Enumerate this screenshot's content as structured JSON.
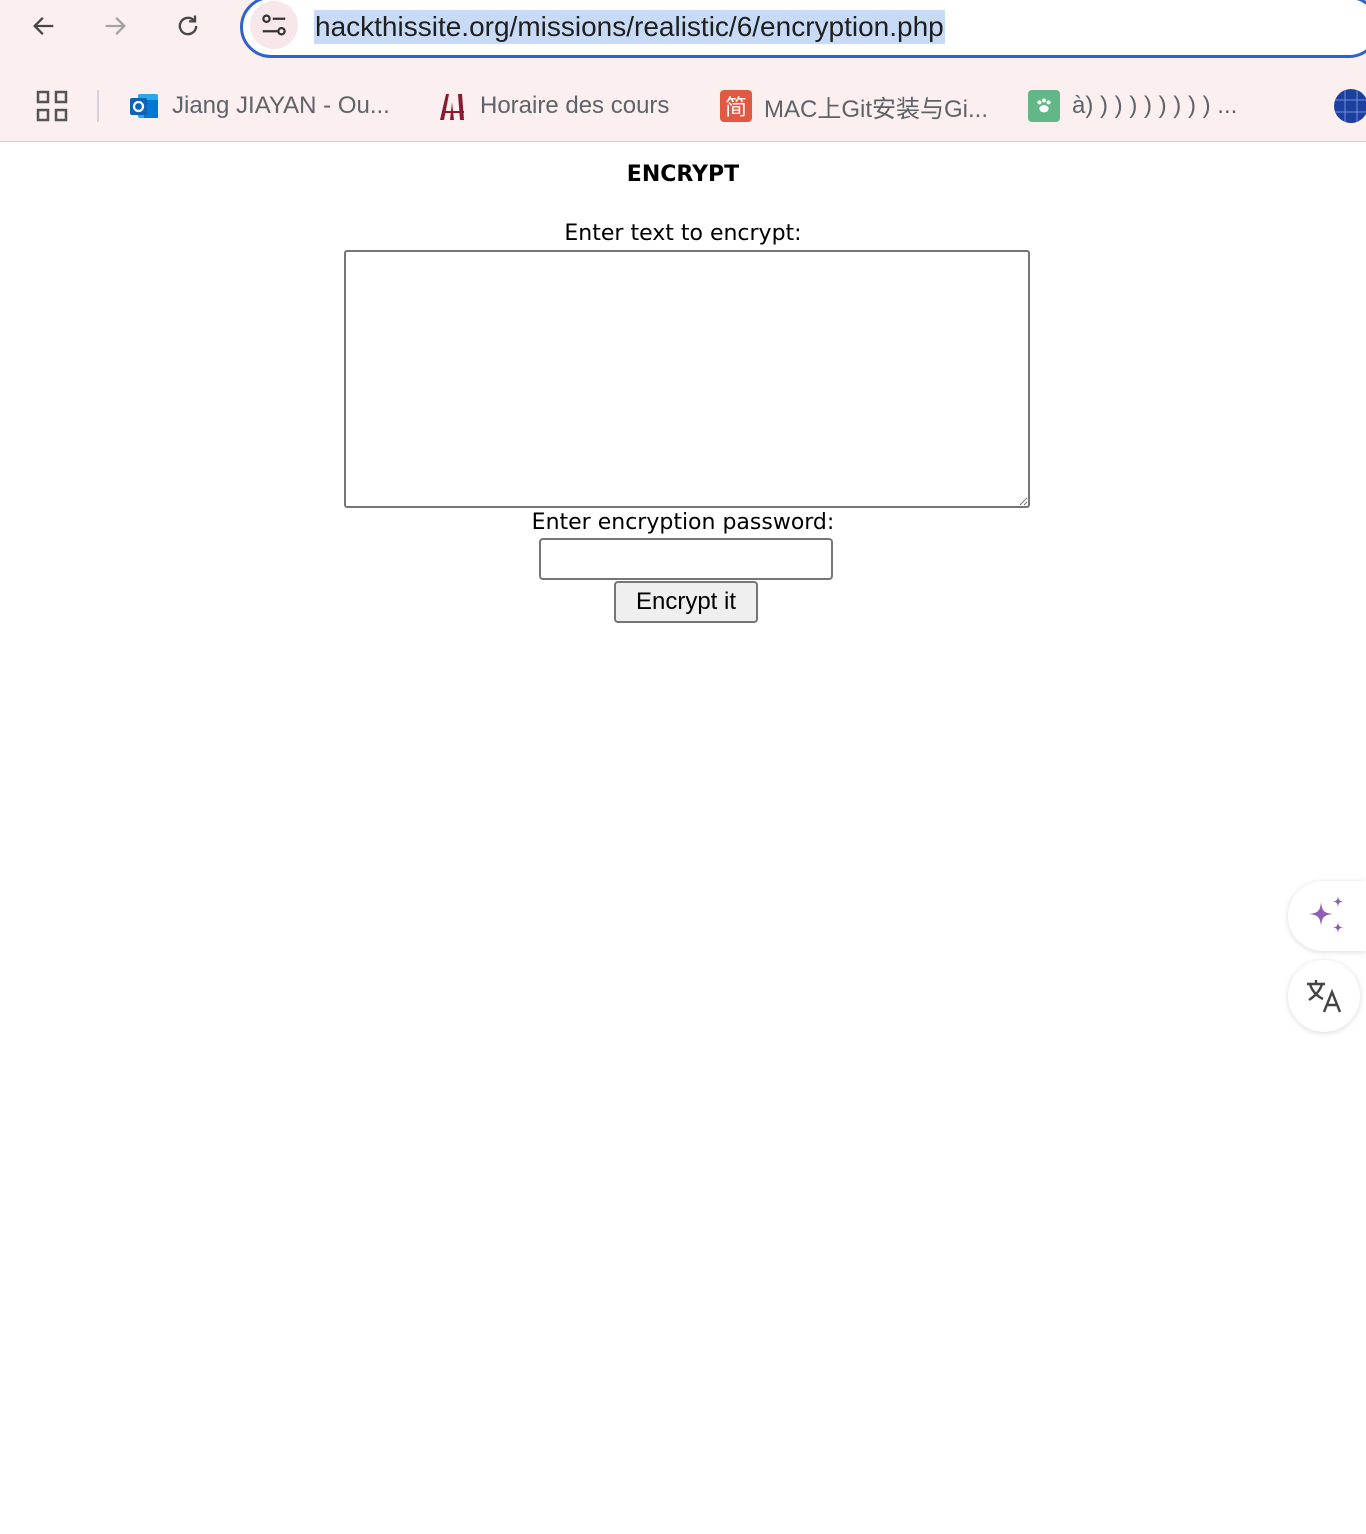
{
  "browser": {
    "url": "hackthissite.org/missions/realistic/6/encryption.php",
    "bookmarks": [
      {
        "label": "Jiang JIAYAN - Ou...",
        "icon": "outlook-icon"
      },
      {
        "label": "Horaire des cours",
        "icon": "university-logo-icon"
      },
      {
        "label": "MAC上Git安装与Gi...",
        "icon": "jianshu-icon",
        "icon_text": "简"
      },
      {
        "label": "à) ) ) ) ) ) ) ) ) ...",
        "icon": "paw-icon"
      }
    ]
  },
  "page": {
    "title": "ENCRYPT",
    "text_label": "Enter text to encrypt:",
    "text_value": "",
    "password_label": "Enter encryption password:",
    "password_value": "",
    "submit_label": "Encrypt it"
  },
  "colors": {
    "chrome_bg": "#fbeff0",
    "url_border": "#2f63c8",
    "url_selection": "#c7dbf6",
    "sparkle": "#8e5fb5"
  }
}
